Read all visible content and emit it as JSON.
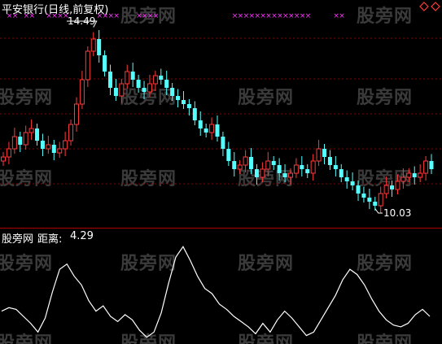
{
  "main_panel": {
    "title": "平安银行(日线,前复权)",
    "high_label": "14.49",
    "low_label": "10.03",
    "title_color": "#ffffff",
    "up_color": "#ff3b3b",
    "down_color": "#54ffff",
    "marker_color": "#ff33ff",
    "diamond_icon": "diamond-outline-icon"
  },
  "indicator_panel": {
    "name": "股旁网",
    "metric_label": "距离:",
    "metric_value": "4.29",
    "line_color": "#ffffff"
  },
  "watermark": {
    "text": "股旁网"
  },
  "chart_data": [
    {
      "type": "candlestick",
      "title": "平安银行(日线,前复权)",
      "annotations": [
        {
          "label": "14.49",
          "value": 14.49,
          "kind": "high"
        },
        {
          "label": "10.03",
          "value": 10.03,
          "kind": "low"
        }
      ],
      "close": [
        11.3,
        11.5,
        11.8,
        11.6,
        11.9,
        12.0,
        11.7,
        11.5,
        11.6,
        11.4,
        11.5,
        11.7,
        12.1,
        12.6,
        13.2,
        13.9,
        14.2,
        13.8,
        13.4,
        13.0,
        12.8,
        13.1,
        13.4,
        13.2,
        13.0,
        12.9,
        13.1,
        13.3,
        13.2,
        13.0,
        12.8,
        12.7,
        12.6,
        12.5,
        12.2,
        12.0,
        11.9,
        12.1,
        11.8,
        11.5,
        11.2,
        11.0,
        11.1,
        11.3,
        11.0,
        10.8,
        11.0,
        11.2,
        11.1,
        10.9,
        10.8,
        10.9,
        11.1,
        11.0,
        10.9,
        11.2,
        11.5,
        11.3,
        11.1,
        11.0,
        10.8,
        10.7,
        10.6,
        10.4,
        10.3,
        10.2,
        10.1,
        10.4,
        10.6,
        10.5,
        10.7,
        10.8,
        10.9,
        10.8,
        10.9,
        11.2,
        11.0
      ],
      "markers_row": "top",
      "grid": true
    },
    {
      "type": "line",
      "name": "距离",
      "last_value": 4.29,
      "values": [
        0.9,
        1.1,
        1.0,
        0.6,
        0.2,
        -0.3,
        0.5,
        2.0,
        3.3,
        3.6,
        2.9,
        2.4,
        1.5,
        0.9,
        1.2,
        0.6,
        0.3,
        0.7,
        0.4,
        -0.2,
        -0.6,
        -0.3,
        0.8,
        2.5,
        4.0,
        4.6,
        3.8,
        2.9,
        2.2,
        1.9,
        1.3,
        1.0,
        0.6,
        0.3,
        0.0,
        -0.4,
        0.2,
        -0.3,
        0.4,
        0.9,
        0.5,
        0.0,
        -0.5,
        -0.3,
        0.4,
        1.1,
        1.8,
        2.7,
        3.3,
        3.0,
        2.4,
        1.6,
        0.9,
        0.4,
        0.1,
        0.0,
        0.2,
        0.7,
        1.0,
        0.6
      ],
      "grid": false
    }
  ]
}
